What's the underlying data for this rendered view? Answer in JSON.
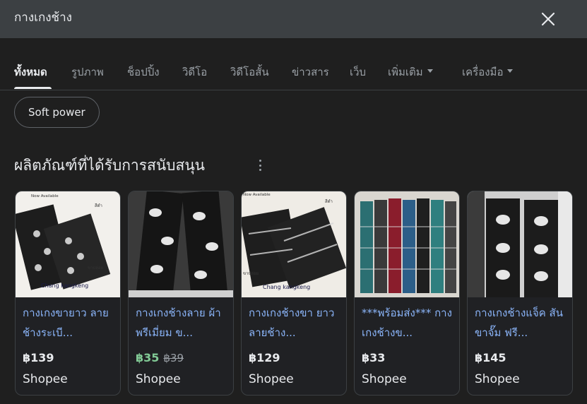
{
  "search": {
    "query": "กางเกงช้าง"
  },
  "tabs": [
    {
      "label": "ทั้งหมด",
      "active": true
    },
    {
      "label": "รูปภาพ"
    },
    {
      "label": "ช็อปปิ้ง"
    },
    {
      "label": "วิดีโอ"
    },
    {
      "label": "วิดีโอสั้น"
    },
    {
      "label": "ข่าวสาร"
    },
    {
      "label": "เว็บ"
    },
    {
      "label": "เพิ่มเติม",
      "dropdown": true
    },
    {
      "label": "เครื่องมือ",
      "dropdown": true
    }
  ],
  "chip": {
    "label": "Soft power"
  },
  "section": {
    "title": "ผลิตภัณฑ์ที่ได้รับการสนับสนุน"
  },
  "products": [
    {
      "title": "กางเกงขายาว ลายช้างระเบี...",
      "price": "฿139",
      "old_price": "",
      "seller": "Shopee",
      "image_text": [
        "Now Available",
        "สีดำ",
        "ขาปล่อย",
        "Chang kangkeng"
      ]
    },
    {
      "title": "กางเกงช้างลาย ผ้าพรีเมี่ยม ข...",
      "price": "฿35",
      "old_price": "฿39",
      "seller": "Shopee",
      "image_text": []
    },
    {
      "title": "กางเกงช้างขา ยาว ลายช้าง...",
      "price": "฿129",
      "old_price": "",
      "seller": "Shopee",
      "image_text": [
        "Now Available",
        "สีดำ",
        "ขาปล่อย",
        "Chang kangkeng"
      ]
    },
    {
      "title": "***พร้อมส่ง*** กางเกงช้างข...",
      "price": "฿33",
      "old_price": "",
      "seller": "Shopee",
      "image_text": []
    },
    {
      "title": "กางเกงช้างแจ็ค สันขาจั๊ม ฟรี...",
      "price": "฿145",
      "old_price": "",
      "seller": "Shopee",
      "image_text": []
    }
  ],
  "colors": {
    "background": "#1f1f1f",
    "link": "#8ab4f8",
    "sale": "#81c995"
  },
  "icons": {
    "close": "close-icon",
    "more": "more-vert-icon"
  }
}
